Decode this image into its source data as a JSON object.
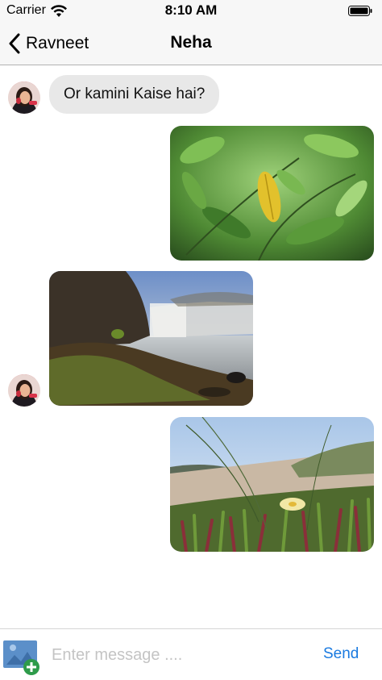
{
  "status_bar": {
    "carrier": "Carrier",
    "time": "8:10 AM",
    "icons": [
      "wifi-icon",
      "battery-icon"
    ]
  },
  "nav": {
    "back_label": "Ravneet",
    "title": "Neha",
    "back_icon": "chevron-left-icon"
  },
  "messages": [
    {
      "type": "text",
      "direction": "incoming",
      "text": "Or kamini Kaise hai?"
    },
    {
      "type": "image",
      "direction": "outgoing",
      "subject": "green-leaves-with-yellow-leaf"
    },
    {
      "type": "image",
      "direction": "incoming",
      "subject": "waterfall-landscape"
    },
    {
      "type": "image",
      "direction": "outgoing",
      "subject": "beach-grass-with-flower"
    }
  ],
  "composer": {
    "placeholder": "Enter message ....",
    "value": "",
    "send_label": "Send",
    "attach_icon": "add-photo-icon"
  },
  "colors": {
    "bar_background": "#f7f7f7",
    "incoming_bubble": "#e8e8e8",
    "send_blue": "#1a7ae0",
    "attach_blue": "#5b8fc9",
    "attach_green": "#2e9b4a"
  }
}
